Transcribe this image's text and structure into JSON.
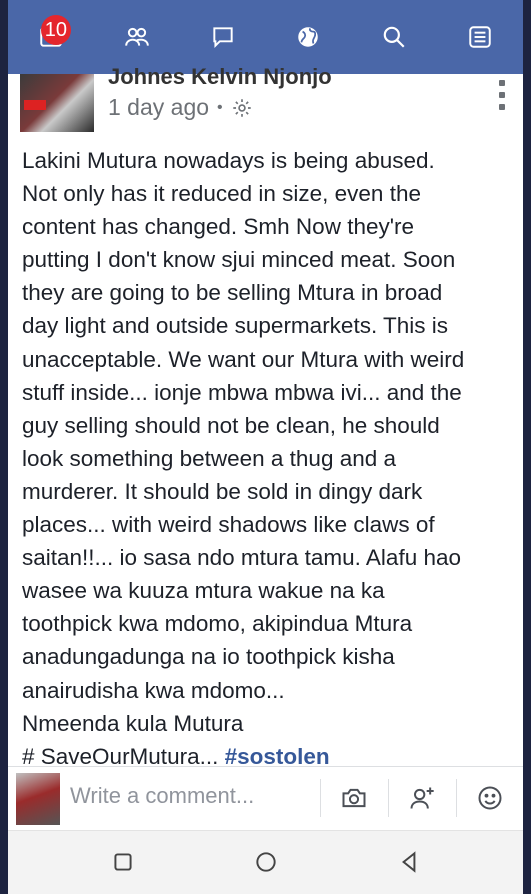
{
  "nav": {
    "notifications_count": "10",
    "icons": [
      "news-feed-icon",
      "friends-icon",
      "messages-icon",
      "globe-icon",
      "search-icon",
      "menu-icon"
    ]
  },
  "post": {
    "author": "Johnes Kelvin Njonjo",
    "time": "1 day ago",
    "separator": "•",
    "body_lines": [
      "Lakini Mutura nowadays is being abused.",
      "Not only has it reduced in size, even the",
      "content has changed. Smh Now they're",
      "putting I don't know sjui minced meat. Soon",
      "they are going to be selling Mtura in broad",
      "day light and outside supermarkets. This is",
      "unacceptable. We want our Mtura with weird",
      "stuff inside... ionje mbwa mbwa ivi... and the",
      "guy selling should not be clean, he should",
      "look something between a thug and a",
      "murderer. It should be sold in dingy dark",
      "places... with weird shadows like claws of",
      "saitan!!... io sasa ndo mtura tamu. Alafu hao",
      "wasee wa kuuza mtura wakue na ka",
      "toothpick kwa mdomo, akipindua Mtura",
      "anadungadunga na io toothpick kisha",
      "anairudisha kwa mdomo...",
      "Nmeenda kula Mutura"
    ],
    "hashtag_line_prefix": "# SaveOurMutura... ",
    "hashtag": "#sostolen"
  },
  "comment": {
    "placeholder": "Write a comment..."
  },
  "colors": {
    "nav_bg": "#4a67a8",
    "badge": "#e4262d",
    "link": "#365899"
  }
}
